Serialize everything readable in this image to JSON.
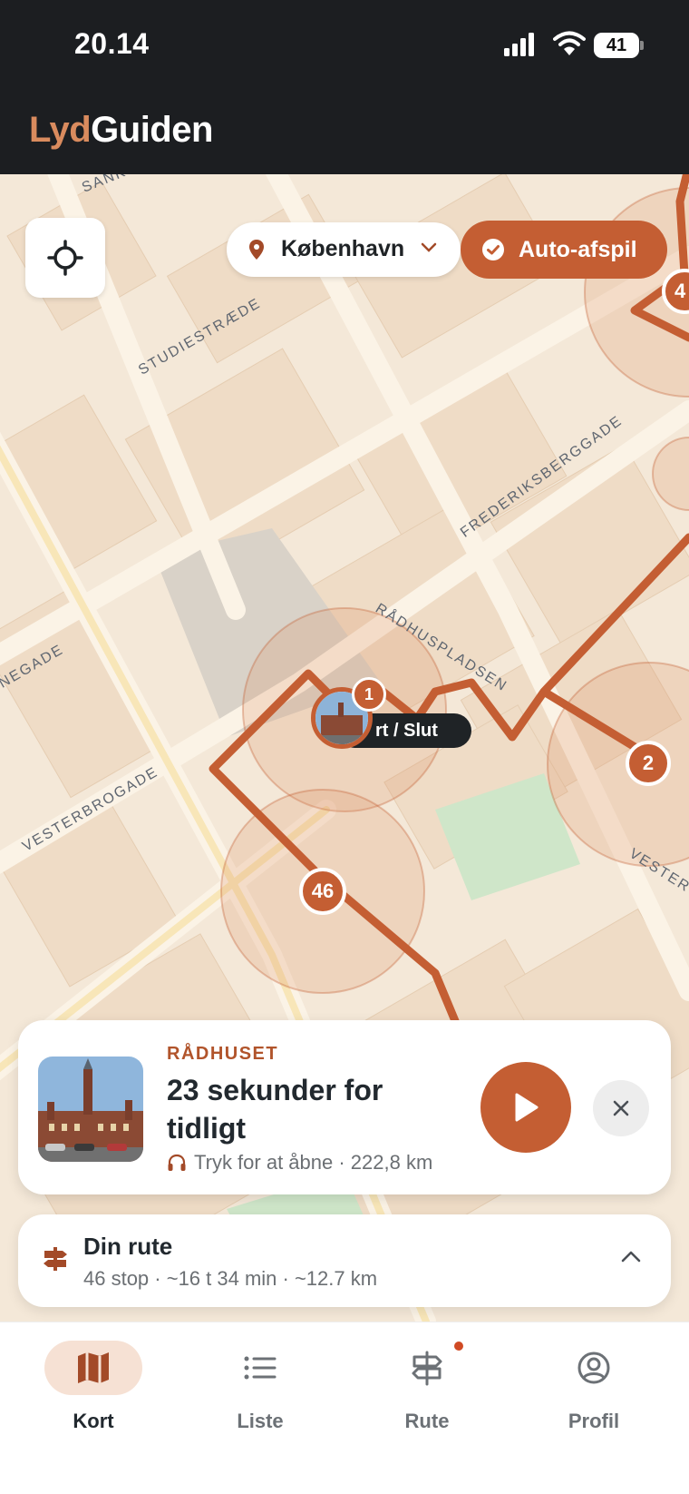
{
  "status_bar": {
    "time": "20.14",
    "battery": "41"
  },
  "app": {
    "logo_part1": "Lyd",
    "logo_part2": "Guiden"
  },
  "map": {
    "streets": {
      "sankt_peder": "SANKT PED",
      "studiestraede": "STUDIESTRÆDE",
      "frederiksberggade": "FREDERIKSBERGGADE",
      "raadhuspladsen": "RÅDHUSPLADSEN",
      "negade": "NEGADE",
      "vesterbrogade": "VESTERBROGADE",
      "vester": "VESTER"
    },
    "markers": {
      "stop1": "1",
      "stop2": "2",
      "stop4": "4",
      "stop46": "46",
      "start_label": "rt / Slut"
    }
  },
  "controls": {
    "city": "København",
    "auto_play": "Auto-afspil"
  },
  "now_playing": {
    "eyebrow": "RÅDHUSET",
    "title": "23 sekunder for tidligt",
    "subtitle": "Tryk for at åbne · 222,8 km"
  },
  "route": {
    "title": "Din rute",
    "meta": "46 stop · ~16 t 34 min · ~12.7 km"
  },
  "tabs": [
    {
      "label": "Kort",
      "icon": "map-icon",
      "active": true
    },
    {
      "label": "Liste",
      "icon": "list-icon",
      "active": false
    },
    {
      "label": "Rute",
      "icon": "signpost-icon",
      "active": false
    },
    {
      "label": "Profil",
      "icon": "profile-icon",
      "active": false
    }
  ],
  "colors": {
    "accent": "#c45e33",
    "header": "#1c1e21",
    "map_bg": "#f4e8d8"
  }
}
